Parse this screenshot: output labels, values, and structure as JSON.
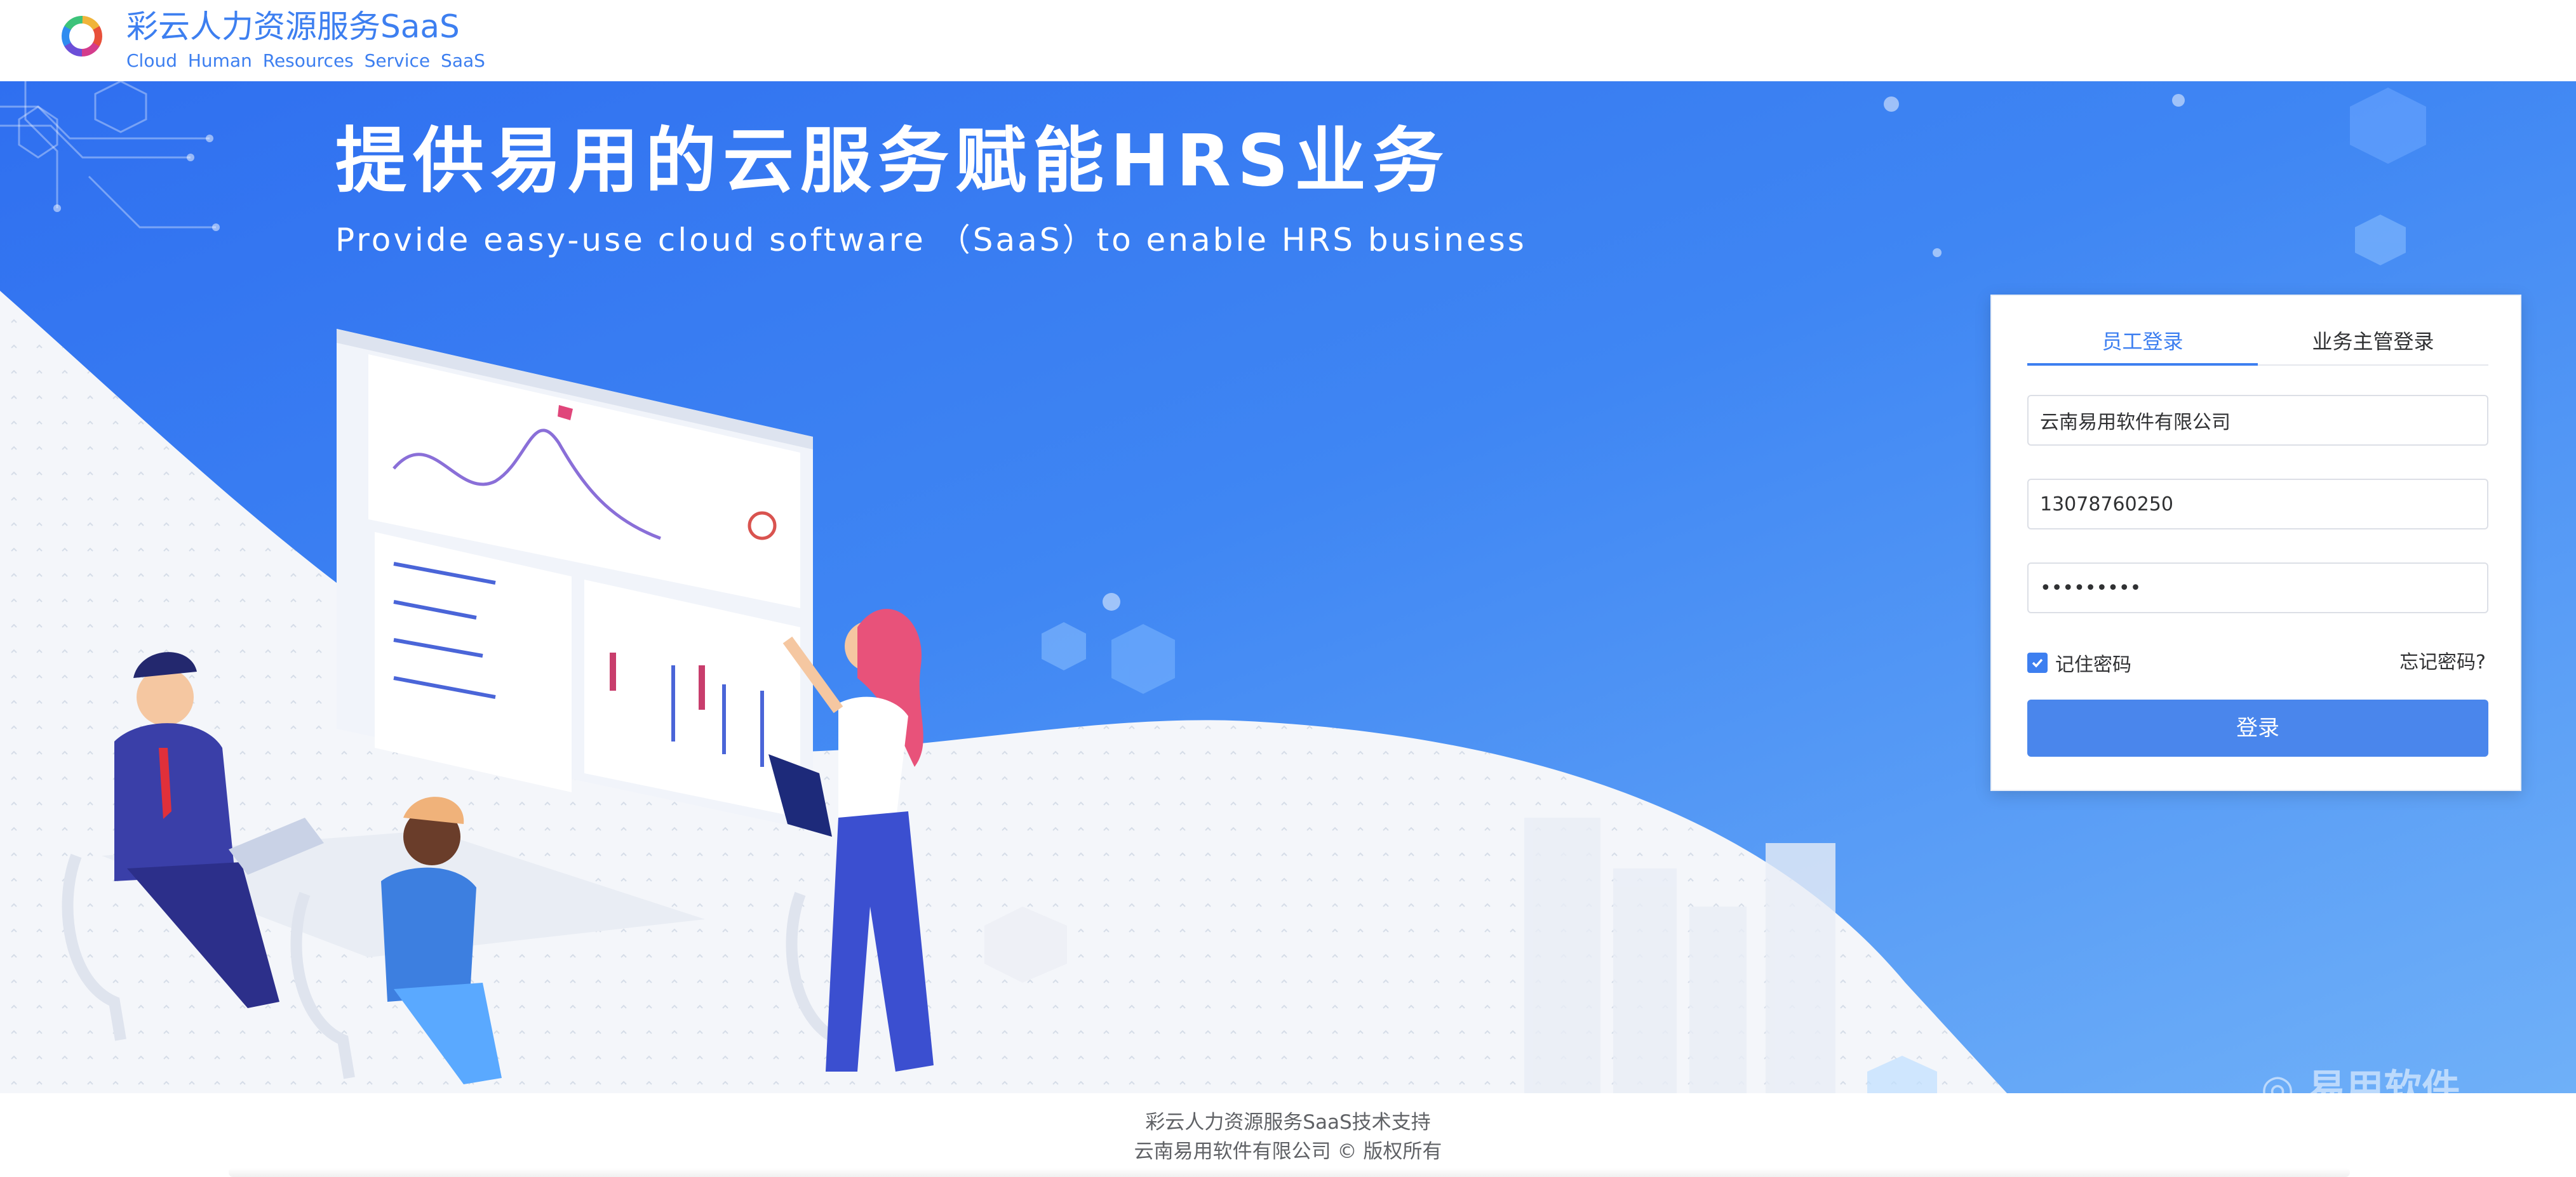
{
  "header": {
    "title": "彩云人力资源服务SaaS",
    "subtitle": "Cloud  Human  Resources  Service  SaaS",
    "logo_icon": "colorful-ring-logo"
  },
  "hero": {
    "title": "提供易用的云服务赋能HRS业务",
    "subtitle": "Provide easy-use cloud software （SaaS）to enable HRS business",
    "watermark": "◎ 易用软件"
  },
  "login": {
    "tabs": [
      {
        "label": "员工登录",
        "active": true
      },
      {
        "label": "业务主管登录",
        "active": false
      }
    ],
    "company_value": "云南易用软件有限公司",
    "phone_value": "13078760250",
    "password_value": "•••••••••",
    "remember_label": "记住密码",
    "remember_checked": true,
    "forgot_label": "忘记密码?",
    "submit_label": "登录",
    "accent_color": "#3d7ff0"
  },
  "footer": {
    "line1": "彩云人力资源服务SaaS技术支持",
    "line2": "云南易用软件有限公司 © 版权所有"
  }
}
